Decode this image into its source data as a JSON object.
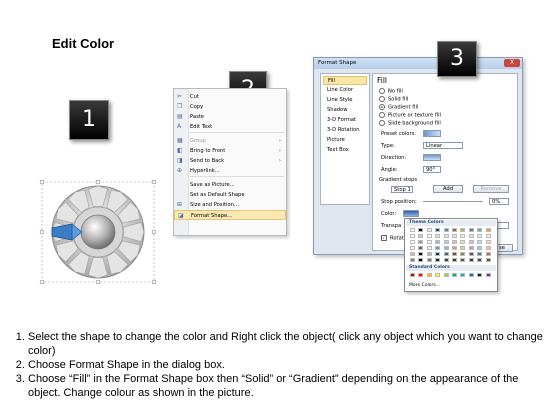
{
  "title": "Edit Color",
  "steps": [
    "1",
    "2",
    "3"
  ],
  "context_menu": {
    "items": [
      {
        "label": "Cut",
        "icon": "scissors-icon",
        "disabled": false
      },
      {
        "label": "Copy",
        "icon": "copy-icon",
        "disabled": false
      },
      {
        "label": "Paste",
        "icon": "paste-icon",
        "disabled": false
      },
      {
        "label": "Edit Text",
        "icon": "edit-text-icon",
        "disabled": false
      },
      {
        "label": "Group",
        "icon": "group-icon",
        "disabled": true,
        "submenu": true
      },
      {
        "label": "Bring to Front",
        "icon": "bring-front-icon",
        "disabled": false,
        "submenu": true
      },
      {
        "label": "Send to Back",
        "icon": "send-back-icon",
        "disabled": false,
        "submenu": true
      },
      {
        "label": "Hyperlink...",
        "icon": "hyperlink-icon",
        "disabled": false
      },
      {
        "label": "Save as Picture...",
        "icon": "",
        "disabled": false
      },
      {
        "label": "Set as Default Shape",
        "icon": "",
        "disabled": false
      },
      {
        "label": "Size and Position...",
        "icon": "size-icon",
        "disabled": false
      },
      {
        "label": "Format Shape...",
        "icon": "format-shape-icon",
        "disabled": false,
        "highlighted": true
      }
    ]
  },
  "dialog": {
    "title": "Format Shape",
    "close_label": "X",
    "nav": [
      "Fill",
      "Line Color",
      "Line Style",
      "Shadow",
      "3-D Format",
      "3-D Rotation",
      "Picture",
      "Text Box"
    ],
    "fill_heading": "Fill",
    "fill_options": [
      "No fill",
      "Solid fill",
      "Gradient fill",
      "Picture or texture fill",
      "Slide background fill"
    ],
    "fill_selected": "Gradient fill",
    "preset_colors_label": "Preset colors:",
    "type_label": "Type:",
    "type_value": "Linear",
    "direction_label": "Direction:",
    "angle_label": "Angle:",
    "angle_value": "90°",
    "gradient_stops_label": "Gradient stops",
    "stop_value": "Stop 1",
    "add_label": "Add",
    "remove_label": "Remove",
    "stop_position_label": "Stop position:",
    "stop_position_value": "0%",
    "color_label": "Color:",
    "transparency_label": "Transpa",
    "rotate_label": "Rotate",
    "close_button_label": "se"
  },
  "palette": {
    "theme_colors_label": "Theme Colors",
    "standard_colors_label": "Standard Colors",
    "more_colors_label": "More Colors...",
    "theme_top_row": [
      "#ffffff",
      "#000000",
      "#eeece1",
      "#1f497d",
      "#4f81bd",
      "#c0504d",
      "#9bbb59",
      "#8064a2",
      "#4bacc6",
      "#f79646"
    ],
    "standard_colors": [
      "#c00000",
      "#ff0000",
      "#ffc000",
      "#ffff00",
      "#92d050",
      "#00b050",
      "#00b0f0",
      "#0070c0",
      "#002060",
      "#7030a0"
    ]
  },
  "instructions": [
    "Select the shape to change the color and Right click the object( click any object which you want to change color)",
    "Choose Format Shape in the dialog box.",
    "Choose “Fill” in the Format Shape box then “Solid” or “Gradient” depending on the appearance of the object. Change colour as shown in the picture."
  ]
}
